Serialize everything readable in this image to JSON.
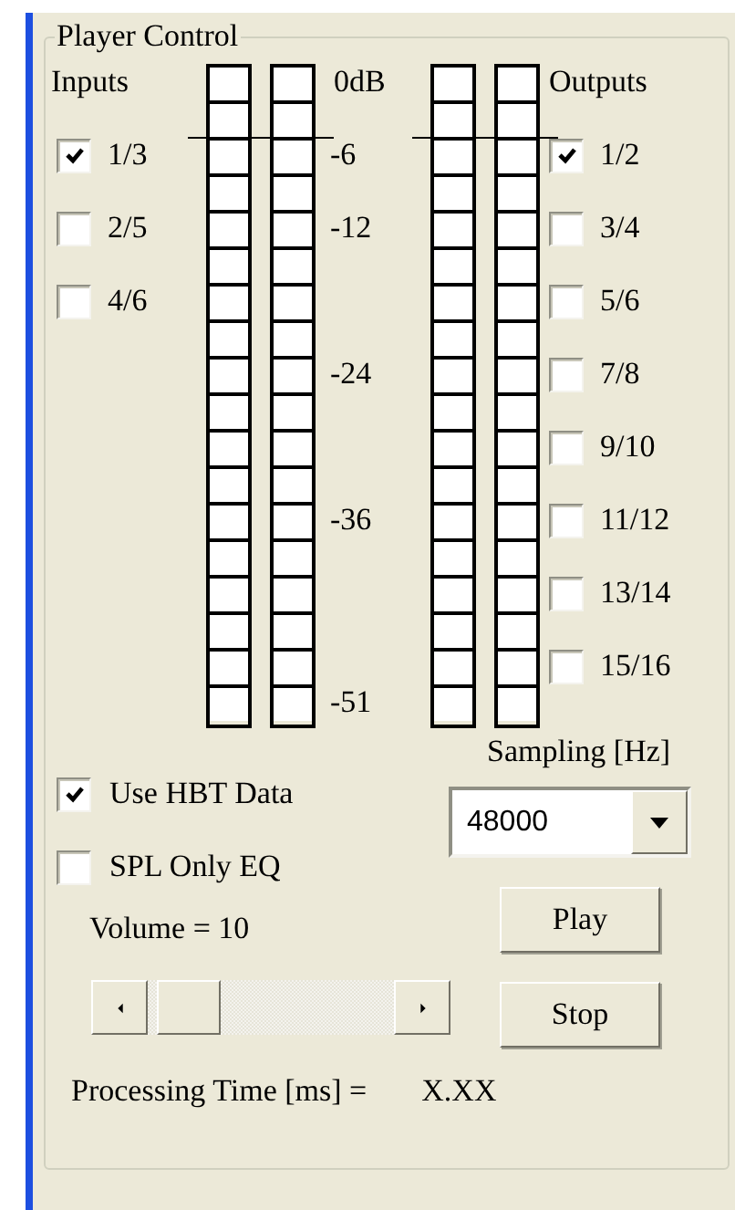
{
  "group": {
    "title": "Player Control"
  },
  "inputs": {
    "label": "Inputs",
    "items": [
      {
        "label": "1/3",
        "checked": true
      },
      {
        "label": "2/5",
        "checked": false
      },
      {
        "label": "4/6",
        "checked": false
      }
    ]
  },
  "input_meters": [
    {
      "level": 0
    },
    {
      "level": 0
    }
  ],
  "scale": [
    "0dB",
    "-6",
    "-12",
    "-24",
    "-36",
    "-51"
  ],
  "output_meters": [
    {
      "level": 0
    },
    {
      "level": 0
    }
  ],
  "outputs": {
    "label": "Outputs",
    "items": [
      {
        "label": "1/2",
        "checked": true
      },
      {
        "label": "3/4",
        "checked": false
      },
      {
        "label": "5/6",
        "checked": false
      },
      {
        "label": "7/8",
        "checked": false
      },
      {
        "label": "9/10",
        "checked": false
      },
      {
        "label": "11/12",
        "checked": false
      },
      {
        "label": "13/14",
        "checked": false
      },
      {
        "label": "15/16",
        "checked": false
      }
    ]
  },
  "options": [
    {
      "label": "Use HBT Data",
      "checked": true
    },
    {
      "label": "SPL Only EQ",
      "checked": false
    }
  ],
  "volume": {
    "label": "Volume = 10",
    "level": 0.03
  },
  "sampling": {
    "label": "Sampling [Hz]",
    "value": "48000"
  },
  "buttons": [
    "Play",
    "Stop"
  ],
  "processing": {
    "label": "Processing Time [ms] =",
    "value": "X.XX"
  }
}
